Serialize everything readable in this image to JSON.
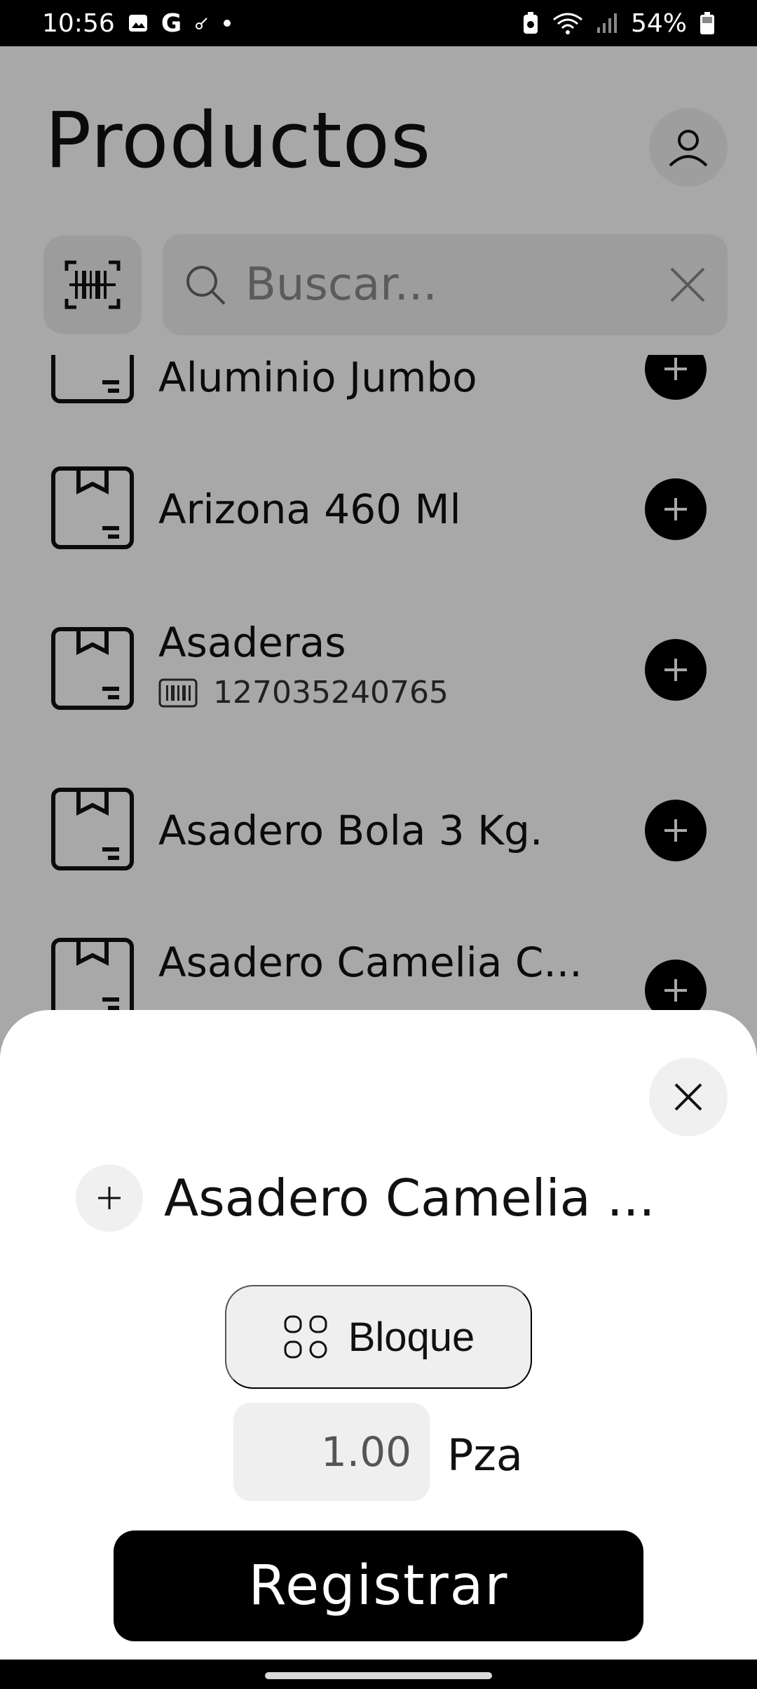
{
  "status_bar": {
    "time": "10:56",
    "left_icons": [
      "gallery-icon",
      "google-icon",
      "key-icon",
      "dot-icon"
    ],
    "right_icons": [
      "battery-saver-icon",
      "wifi-icon",
      "signal-icon",
      "battery-icon"
    ],
    "battery": "54%"
  },
  "header": {
    "title": "Productos",
    "search_placeholder": "Buscar..."
  },
  "products": [
    {
      "name": "Aluminio Jumbo",
      "code": ""
    },
    {
      "name": "Arizona 460 Ml",
      "code": ""
    },
    {
      "name": "Asaderas",
      "code": "127035240765"
    },
    {
      "name": "Asadero Bola 3 Kg.",
      "code": ""
    },
    {
      "name": "Asadero Camelia C...",
      "code": ""
    }
  ],
  "sheet": {
    "product_title": "Asadero Camelia ...",
    "type_label": "Bloque",
    "quantity": "1.00",
    "unit": "Pza",
    "register_label": "Registrar"
  },
  "colors": {
    "accent": "#000000",
    "surface": "#efefef",
    "overlay": "rgba(0,0,0,0.34)"
  }
}
